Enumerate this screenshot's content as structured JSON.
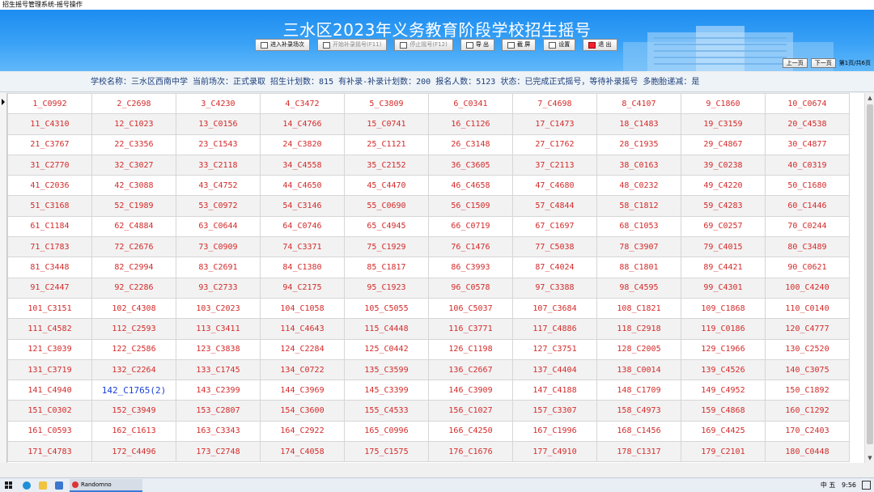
{
  "window": {
    "title": "招生摇号管理系统-摇号操作"
  },
  "banner": {
    "title": "三水区2023年义务教育阶段学校招生摇号"
  },
  "toolbar": [
    {
      "label": "进入补录场次",
      "icon": "enter-icon",
      "enabled": true
    },
    {
      "label": "开始补录摇号(F11)",
      "icon": "play-icon",
      "enabled": false
    },
    {
      "label": "停止摇号(F12)",
      "icon": "stop-icon",
      "enabled": false
    },
    {
      "label": "导 出",
      "icon": "export-icon",
      "enabled": true
    },
    {
      "label": "截 屏",
      "icon": "screenshot-icon",
      "enabled": true
    },
    {
      "label": "设置",
      "icon": "settings-icon",
      "enabled": true
    },
    {
      "label": "退 出",
      "icon": "exit-icon",
      "enabled": true
    }
  ],
  "pager": {
    "prev": "上一页",
    "next": "下一页",
    "info": "第1页/共6页"
  },
  "info": {
    "text": "学校名称：三水区西南中学  当前场次：正式录取  招生计划数：815  有补录-补录计划数：200  报名人数：5123  状态：已完成正式摇号，等待补录摇号  多胞胎递减：是"
  },
  "grid": {
    "highlight": "142_C1765(2)",
    "rows": [
      [
        "1_C0992",
        "2_C2698",
        "3_C4230",
        "4_C3472",
        "5_C3809",
        "6_C0341",
        "7_C4698",
        "8_C4107",
        "9_C1860",
        "10_C0674"
      ],
      [
        "11_C4310",
        "12_C1023",
        "13_C0156",
        "14_C4766",
        "15_C0741",
        "16_C1126",
        "17_C1473",
        "18_C1483",
        "19_C3159",
        "20_C4538"
      ],
      [
        "21_C3767",
        "22_C3356",
        "23_C1543",
        "24_C3820",
        "25_C1121",
        "26_C3148",
        "27_C1762",
        "28_C1935",
        "29_C4867",
        "30_C4877"
      ],
      [
        "31_C2770",
        "32_C3027",
        "33_C2118",
        "34_C4558",
        "35_C2152",
        "36_C3605",
        "37_C2113",
        "38_C0163",
        "39_C0238",
        "40_C0319"
      ],
      [
        "41_C2036",
        "42_C3088",
        "43_C4752",
        "44_C4650",
        "45_C4470",
        "46_C4658",
        "47_C4680",
        "48_C0232",
        "49_C4220",
        "50_C1680"
      ],
      [
        "51_C3168",
        "52_C1989",
        "53_C0972",
        "54_C3146",
        "55_C0690",
        "56_C1509",
        "57_C4844",
        "58_C1812",
        "59_C4283",
        "60_C1446"
      ],
      [
        "61_C1184",
        "62_C4884",
        "63_C0644",
        "64_C0746",
        "65_C4945",
        "66_C0719",
        "67_C1697",
        "68_C1053",
        "69_C0257",
        "70_C0244"
      ],
      [
        "71_C1783",
        "72_C2676",
        "73_C0909",
        "74_C3371",
        "75_C1929",
        "76_C1476",
        "77_C5038",
        "78_C3907",
        "79_C4015",
        "80_C3489"
      ],
      [
        "81_C3448",
        "82_C2994",
        "83_C2691",
        "84_C1380",
        "85_C1817",
        "86_C3993",
        "87_C4024",
        "88_C1801",
        "89_C4421",
        "90_C0621"
      ],
      [
        "91_C2447",
        "92_C2286",
        "93_C2733",
        "94_C2175",
        "95_C1923",
        "96_C0578",
        "97_C3388",
        "98_C4595",
        "99_C4301",
        "100_C4240"
      ],
      [
        "101_C3151",
        "102_C4308",
        "103_C2023",
        "104_C1058",
        "105_C5055",
        "106_C5037",
        "107_C3684",
        "108_C1821",
        "109_C1868",
        "110_C0140"
      ],
      [
        "111_C4582",
        "112_C2593",
        "113_C3411",
        "114_C4643",
        "115_C4448",
        "116_C3771",
        "117_C4886",
        "118_C2918",
        "119_C0186",
        "120_C4777"
      ],
      [
        "121_C3039",
        "122_C2586",
        "123_C3838",
        "124_C2284",
        "125_C0442",
        "126_C1198",
        "127_C3751",
        "128_C2005",
        "129_C1966",
        "130_C2520"
      ],
      [
        "131_C3719",
        "132_C2264",
        "133_C1745",
        "134_C0722",
        "135_C3599",
        "136_C2667",
        "137_C4404",
        "138_C0014",
        "139_C4526",
        "140_C3075"
      ],
      [
        "141_C4940",
        "142_C1765(2)",
        "143_C2399",
        "144_C3969",
        "145_C3399",
        "146_C3909",
        "147_C4188",
        "148_C1709",
        "149_C4952",
        "150_C1892"
      ],
      [
        "151_C0302",
        "152_C3949",
        "153_C2807",
        "154_C3600",
        "155_C4533",
        "156_C1027",
        "157_C3307",
        "158_C4973",
        "159_C4868",
        "160_C1292"
      ],
      [
        "161_C0593",
        "162_C1613",
        "163_C3343",
        "164_C2922",
        "165_C0996",
        "166_C4250",
        "167_C1996",
        "168_C1456",
        "169_C4425",
        "170_C2403"
      ],
      [
        "171_C4783",
        "172_C4496",
        "173_C2748",
        "174_C4058",
        "175_C1575",
        "176_C1676",
        "177_C4910",
        "178_C1317",
        "179_C2101",
        "180_C0448"
      ]
    ]
  },
  "taskbar": {
    "app_label": "Randomno",
    "tray": "中  五",
    "time": "9:56"
  },
  "colors": {
    "banner": "#1c8cf0",
    "cell_text": "#d42a2a",
    "highlight_text": "#1a3fd8"
  }
}
